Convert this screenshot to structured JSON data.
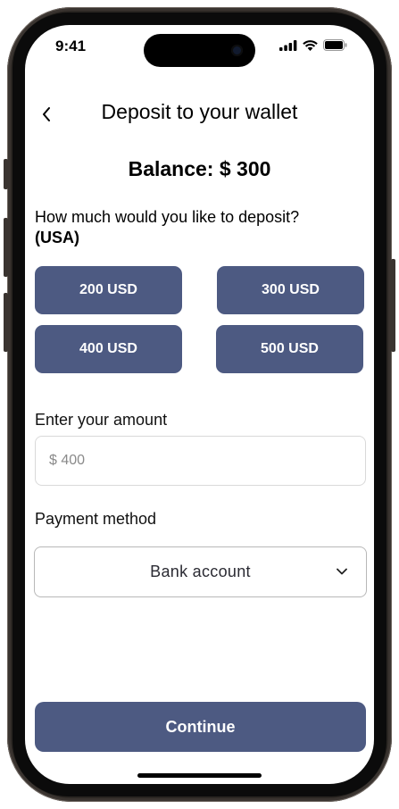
{
  "status_bar": {
    "time": "9:41",
    "icons": [
      "signal-icon",
      "wifi-icon",
      "battery-icon"
    ]
  },
  "header": {
    "back_icon": "chevron-left-icon",
    "title": "Deposit to your wallet"
  },
  "balance": {
    "text": "Balance: $ 300"
  },
  "deposit_prompt": {
    "question": "How much would you like to deposit?",
    "region": "(USA)"
  },
  "amount_options": [
    {
      "label": "200 USD"
    },
    {
      "label": "300 USD"
    },
    {
      "label": "400 USD"
    },
    {
      "label": "500 USD"
    }
  ],
  "custom_amount": {
    "label": "Enter your amount",
    "placeholder": "$ 400",
    "value": ""
  },
  "payment_method": {
    "label": "Payment method",
    "selected": "Bank account",
    "icon": "chevron-down-icon"
  },
  "footer": {
    "continue_label": "Continue"
  },
  "colors": {
    "accent": "#4d5a82",
    "text": "#000000",
    "input_border": "#d9d9d9"
  }
}
